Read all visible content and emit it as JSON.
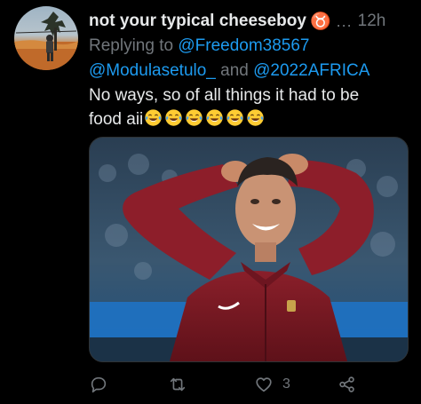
{
  "tweet": {
    "author_name": "not your typical cheeseboy",
    "zodiac_symbol": "♉",
    "more_label": "...",
    "time": "12h",
    "replying_prefix": "Replying to",
    "mention_1": "@Freedom38567",
    "mention_2": "@Modulasetulo_",
    "and_word": "and",
    "mention_3": "@2022AFRICA",
    "text_line_1": "No ways, so of all things it had to be",
    "text_line_2": "food aii",
    "emoji_name": "face-with-tears-of-joy",
    "emoji_count": 6
  },
  "actions": {
    "reply_icon": "reply-icon",
    "retweet_icon": "retweet-icon",
    "like_icon": "heart-icon",
    "like_count": "3",
    "share_icon": "share-icon"
  },
  "colors": {
    "background": "#000000",
    "text": "#e7e9ea",
    "muted": "#71767b",
    "link": "#1d9bf0",
    "zodiac": "#ff6a1a"
  }
}
